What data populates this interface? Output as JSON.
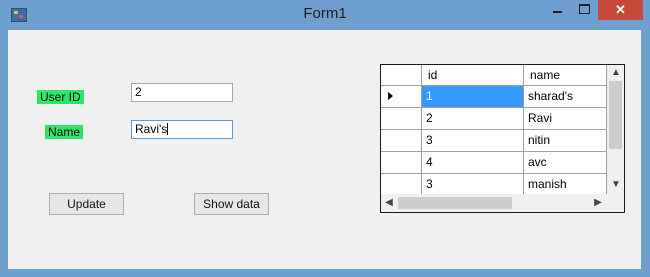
{
  "window": {
    "title": "Form1",
    "minimize_glyph": "",
    "maximize_glyph": "",
    "close_glyph": "✕"
  },
  "form": {
    "user_id_label": "User ID",
    "user_id_value": "2",
    "name_label": "Name",
    "name_value": "Ravi's",
    "update_button": "Update",
    "show_data_button": "Show data"
  },
  "grid": {
    "columns": [
      "id",
      "name"
    ],
    "rows": [
      {
        "id": "1",
        "name": "sharad's"
      },
      {
        "id": "2",
        "name": "Ravi"
      },
      {
        "id": "3",
        "name": "nitin"
      },
      {
        "id": "4",
        "name": "avc"
      },
      {
        "id": "3",
        "name": "manish"
      }
    ],
    "current_row_index": 0
  },
  "colors": {
    "label_highlight": "#2ee56a",
    "selection": "#3399ff",
    "close_button": "#c7493a",
    "title_bar": "#6f9fcf"
  }
}
